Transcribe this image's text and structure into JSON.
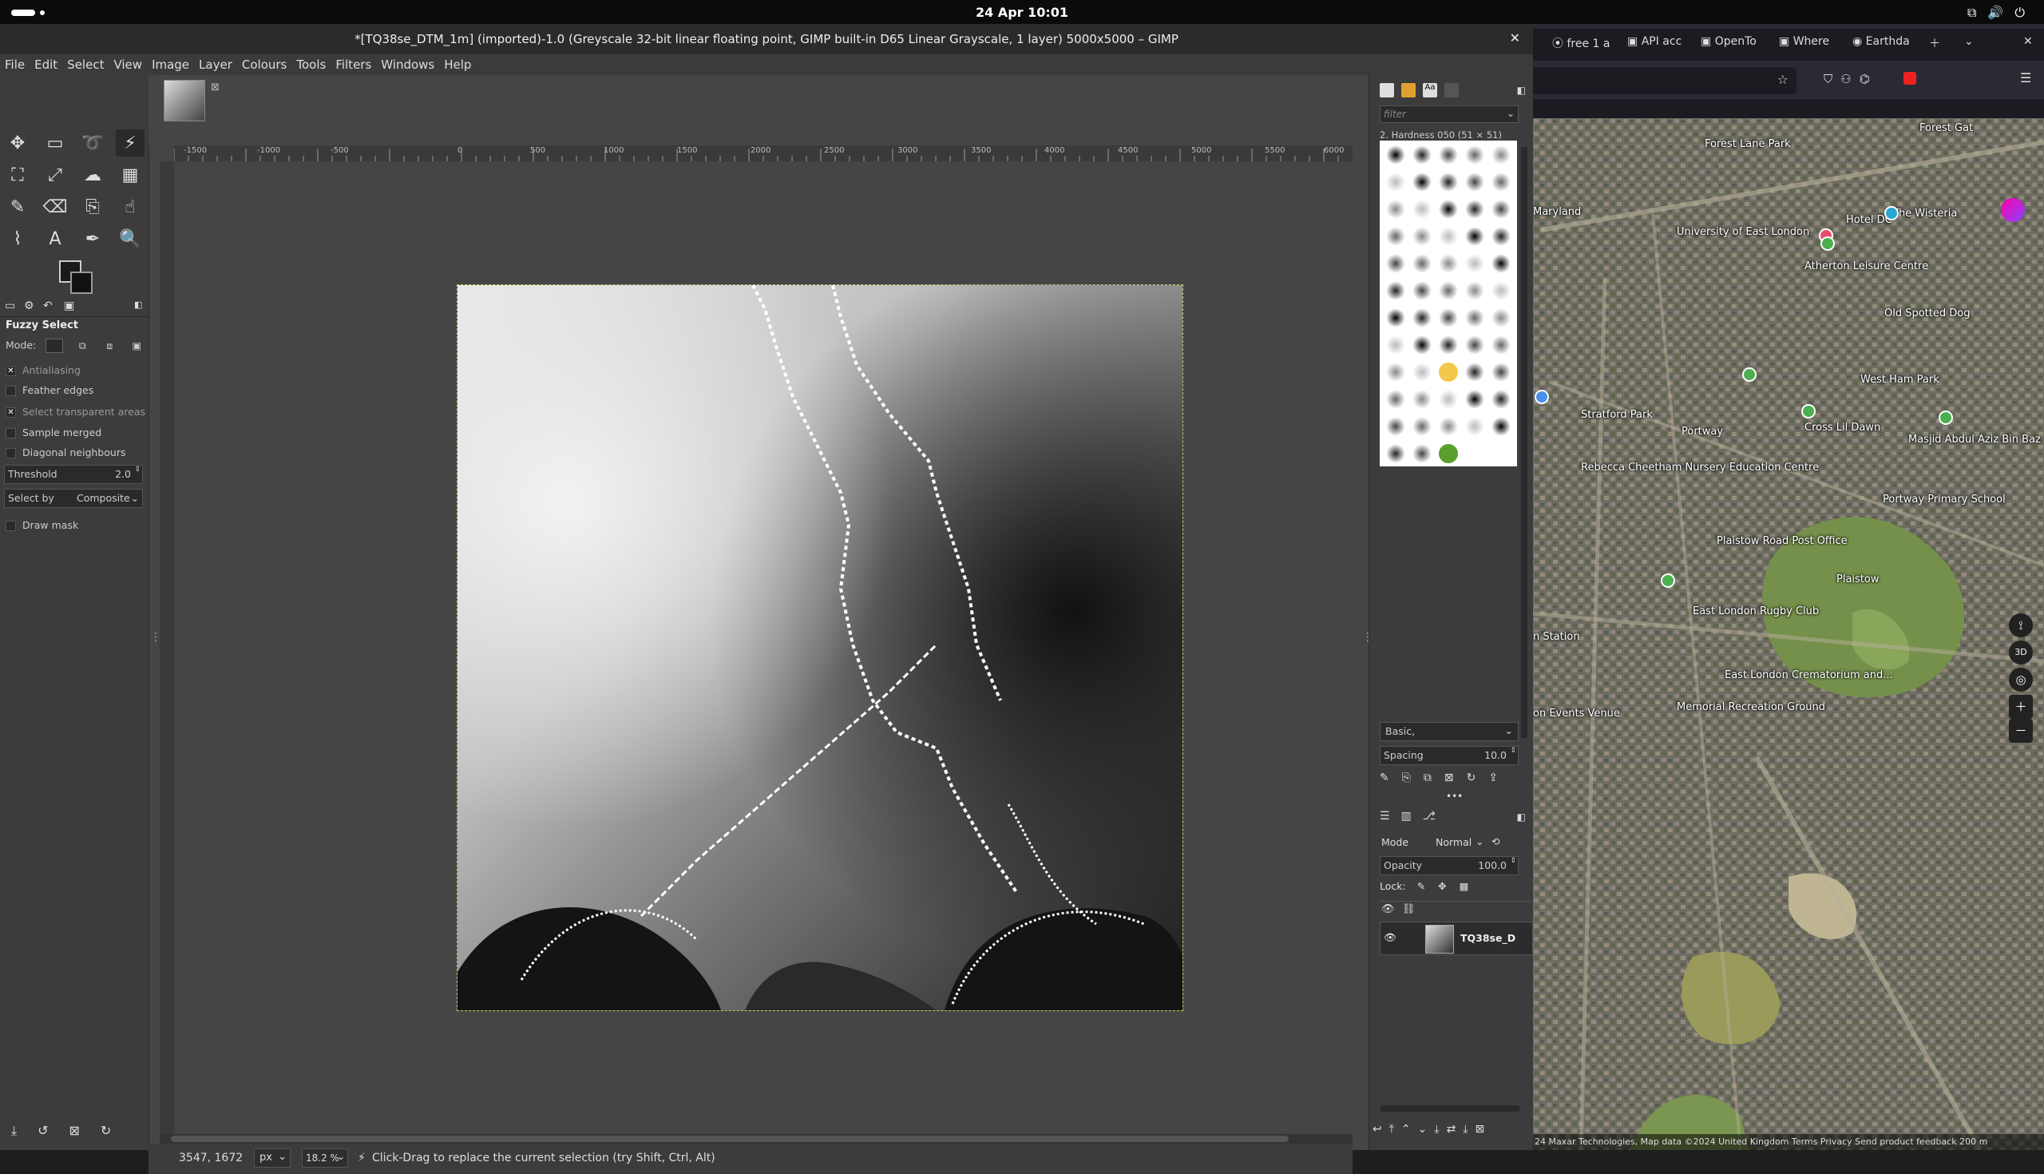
{
  "system": {
    "clock": "24 Apr 10:01"
  },
  "gimp": {
    "title": "*[TQ38se_DTM_1m] (imported)-1.0 (Greyscale 32-bit linear floating point, GIMP built-in D65 Linear Grayscale, 1 layer) 5000x5000 – GIMP",
    "menu": [
      "File",
      "Edit",
      "Select",
      "View",
      "Image",
      "Layer",
      "Colours",
      "Tools",
      "Filters",
      "Windows",
      "Help"
    ],
    "tool_options": {
      "title": "Fuzzy Select",
      "mode_label": "Mode:",
      "antialiasing": "Antialiasing",
      "feather_edges": "Feather edges",
      "select_transparent": "Select transparent areas",
      "sample_merged": "Sample merged",
      "diagonal_neighbours": "Diagonal neighbours",
      "threshold_label": "Threshold",
      "threshold_value": "2.0",
      "select_by_label": "Select by",
      "select_by_value": "Composite",
      "draw_mask": "Draw mask"
    },
    "ruler_ticks": [
      "-1500",
      "-1000",
      "-500",
      "0",
      "500",
      "1000",
      "1500",
      "2000",
      "2500",
      "3000",
      "3500",
      "4000",
      "4500",
      "5000",
      "5500",
      "6000"
    ],
    "status": {
      "coords": "3547, 1672",
      "unit": "px",
      "zoom": "18.2 %",
      "message": "Click-Drag to replace the current selection (try Shift, Ctrl, Alt)"
    },
    "dock": {
      "filter_placeholder": "filter",
      "brush_caption": "2. Hardness 050 (51 × 51)",
      "brush_set": "Basic,",
      "spacing_label": "Spacing",
      "spacing_value": "10.0",
      "mode_label": "Mode",
      "mode_value": "Normal",
      "opacity_label": "Opacity",
      "opacity_value": "100.0",
      "lock_label": "Lock:",
      "layer_name": "TQ38se_D"
    }
  },
  "firefox": {
    "tabs": [
      "free 1 a",
      "API acc",
      "OpenTo",
      "Where",
      "Earthda"
    ],
    "map": {
      "labels": [
        {
          "text": "Forest Lane Park",
          "x": "81",
          "y": "55"
        },
        {
          "text": "Maryland",
          "x": "0",
          "y": "141"
        },
        {
          "text": "University of East London",
          "x": "84",
          "y": "168"
        },
        {
          "text": "Hotel DC",
          "x": "244",
          "y": "151"
        },
        {
          "text": "The Wisteria",
          "x": "312",
          "y": "147"
        },
        {
          "text": "Atherton Leisure Centre",
          "x": "205",
          "y": "196"
        },
        {
          "text": "Old Spotted Dog",
          "x": "270",
          "y": "254"
        },
        {
          "text": "West Ham Park",
          "x": "262",
          "y": "345"
        },
        {
          "text": "Stratford Park",
          "x": "38",
          "y": "392"
        },
        {
          "text": "Cross Lil Dawn",
          "x": "203",
          "y": "411"
        },
        {
          "text": "Masjid Abdul Aziz Bin Baz",
          "x": "288",
          "y": "428"
        },
        {
          "text": "Portway",
          "x": "130",
          "y": "416"
        },
        {
          "text": "Rebecca Cheetham Nursery Education Centre",
          "x": "18",
          "y": "457"
        },
        {
          "text": "Portway Primary School",
          "x": "270",
          "y": "500"
        },
        {
          "text": "Plaistow Road Post Office",
          "x": "155",
          "y": "553"
        },
        {
          "text": "Plaistow",
          "x": "244",
          "y": "601"
        },
        {
          "text": "East London Rugby Club",
          "x": "123",
          "y": "642"
        },
        {
          "text": "n Station",
          "x": "0",
          "y": "676"
        },
        {
          "text": "East London Crematorium and...",
          "x": "150",
          "y": "715"
        },
        {
          "text": "Memorial Recreation Ground",
          "x": "110",
          "y": "755"
        },
        {
          "text": "on Events Venue",
          "x": "0",
          "y": "753"
        }
      ],
      "attribution": "24 Maxar Technologies, Map data ©2024   United Kingdom   Terms   Privacy   Send product feedback   200 m"
    }
  },
  "colors": {
    "gimp_bg": "#454545",
    "panel": "#3c3c3c",
    "accent": "#ffffff"
  }
}
